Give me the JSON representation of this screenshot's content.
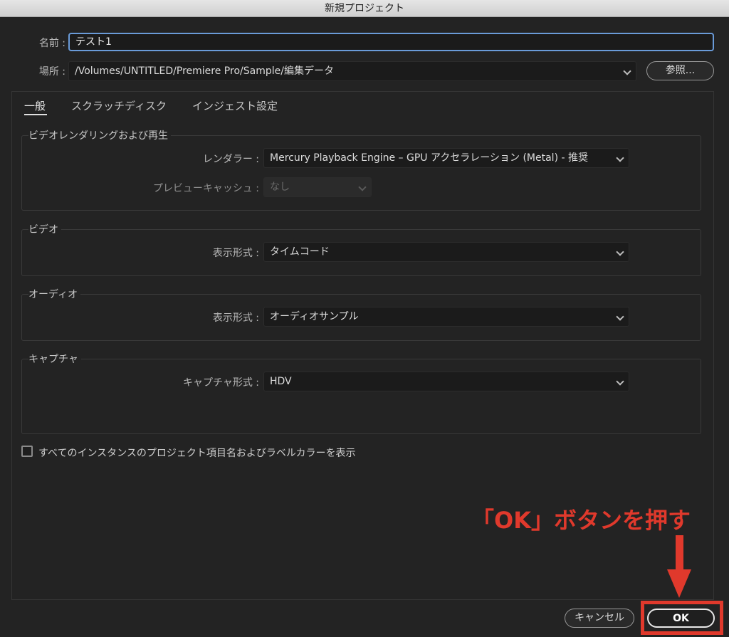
{
  "window": {
    "title": "新規プロジェクト"
  },
  "name_field": {
    "label": "名前 :",
    "value": "テスト1"
  },
  "location": {
    "label": "場所 :",
    "value": "/Volumes/UNTITLED/Premiere Pro/Sample/編集データ",
    "browse_label": "参照..."
  },
  "tabs": [
    {
      "label": "一般",
      "active": true
    },
    {
      "label": "スクラッチディスク",
      "active": false
    },
    {
      "label": "インジェスト設定",
      "active": false
    }
  ],
  "sections": {
    "video_render": {
      "title": "ビデオレンダリングおよび再生",
      "renderer_label": "レンダラー :",
      "renderer_value": "Mercury Playback Engine – GPU アクセラレーション (Metal) - 推奨",
      "preview_cache_label": "プレビューキャッシュ :",
      "preview_cache_value": "なし"
    },
    "video": {
      "title": "ビデオ",
      "format_label": "表示形式 :",
      "format_value": "タイムコード"
    },
    "audio": {
      "title": "オーディオ",
      "format_label": "表示形式 :",
      "format_value": "オーディオサンプル"
    },
    "capture": {
      "title": "キャプチャ",
      "format_label": "キャプチャ形式 :",
      "format_value": "HDV"
    }
  },
  "checkbox": {
    "label": "すべてのインスタンスのプロジェクト項目名およびラベルカラーを表示",
    "checked": false
  },
  "buttons": {
    "cancel": "キャンセル",
    "ok": "OK"
  },
  "annotation": {
    "text": "「OK」ボタンを押す",
    "color": "#e0392c"
  },
  "icons": [
    "chevron-down-icon",
    "checkbox-icon",
    "arrow-down-icon"
  ]
}
